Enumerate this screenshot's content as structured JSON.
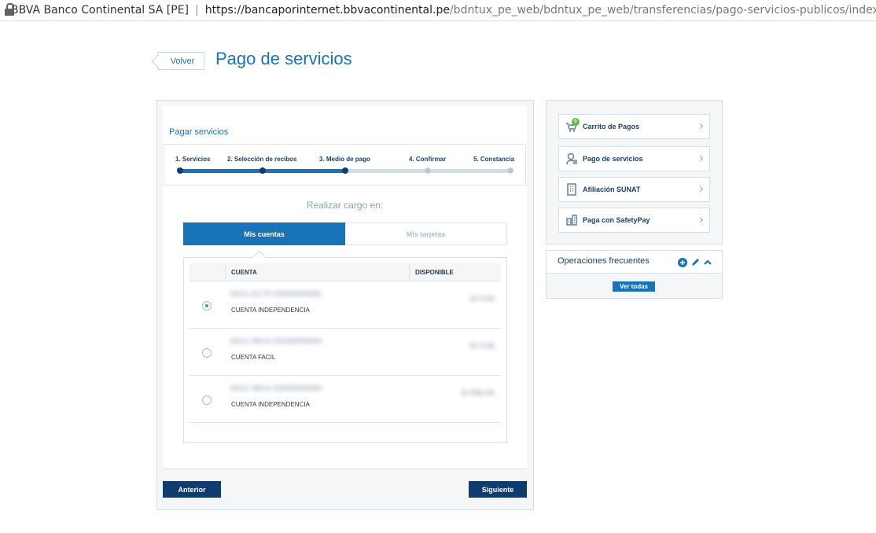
{
  "browser": {
    "site_name": "BBVA Banco Continental SA [PE]",
    "url_host": "https://bancaporinternet.bbvacontinental.pe",
    "url_path": "/bdntux_pe_web/bdntux_pe_web/transferencias/pago-servicios-publicos/index?partida=cuen..."
  },
  "header": {
    "back_label": "Volver",
    "title": "Pago de servicios"
  },
  "main": {
    "section_title": "Pagar servicios",
    "steps": [
      {
        "label": "1. Servicios",
        "status": "done"
      },
      {
        "label": "2. Selección de recibos",
        "status": "done"
      },
      {
        "label": "3. Medio de pago",
        "status": "current"
      },
      {
        "label": "4. Confirmar",
        "status": "todo"
      },
      {
        "label": "5. Constancia",
        "status": "todo"
      }
    ],
    "cargo_label": "Realizar cargo en:",
    "tabs": [
      {
        "label": "Mis cuentas",
        "active": true
      },
      {
        "label": "Mis tarjetas",
        "active": false
      }
    ],
    "table": {
      "col_account": "CUENTA",
      "col_available": "DISPONIBLE",
      "rows": [
        {
          "number": "0011-0170-0200000000",
          "type": "CUENTA INDEPENDENCIA",
          "balance": "S/ 0.00",
          "selected": true
        },
        {
          "number": "0011-0814-0200000000",
          "type": "CUENTA FACIL",
          "balance": "S/ 0.00",
          "selected": false
        },
        {
          "number": "0011-0814-0200000000",
          "type": "CUENTA INDEPENDENCIA",
          "balance": "S/ 000.00",
          "selected": false
        }
      ]
    },
    "prev_label": "Anterior",
    "next_label": "Siguiente"
  },
  "sidebar": {
    "items": [
      {
        "label": "Carrito de Pagos",
        "icon": "cart-icon",
        "badge": "0"
      },
      {
        "label": "Pago de servicios",
        "icon": "service-icon"
      },
      {
        "label": "Afiliación SUNAT",
        "icon": "building-icon"
      },
      {
        "label": "Paga con SafetyPay",
        "icon": "safetypay-icon"
      }
    ],
    "frequent": {
      "title": "Operaciones frecuentes",
      "view_all_label": "Ver todas"
    }
  },
  "colors": {
    "primary": "#1973b8",
    "dark": "#0f3c6e",
    "badge": "#5bbf3f"
  }
}
